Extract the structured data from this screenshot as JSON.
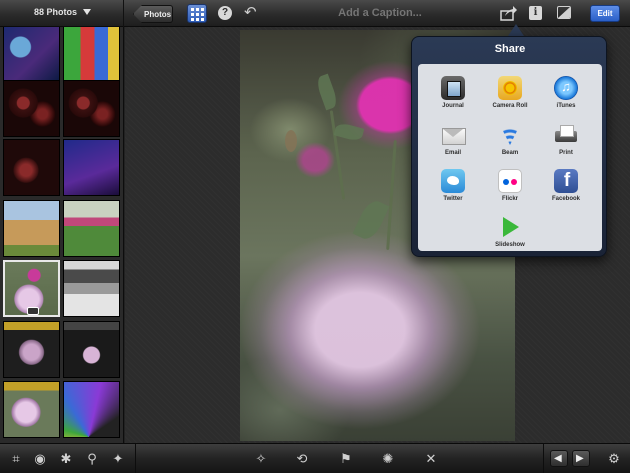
{
  "header": {
    "photo_count": "88 Photos",
    "back_label": "Photos",
    "help_glyph": "?",
    "caption_placeholder": "Add a Caption...",
    "info_glyph": "i",
    "edit_label": "Edit"
  },
  "share": {
    "title": "Share",
    "items": [
      {
        "label": "Journal",
        "icon": "journal-icon"
      },
      {
        "label": "Camera Roll",
        "icon": "camera-roll-icon"
      },
      {
        "label": "iTunes",
        "icon": "itunes-icon"
      },
      {
        "label": "Email",
        "icon": "email-icon"
      },
      {
        "label": "Beam",
        "icon": "beam-icon"
      },
      {
        "label": "Print",
        "icon": "print-icon"
      },
      {
        "label": "Twitter",
        "icon": "twitter-icon"
      },
      {
        "label": "Flickr",
        "icon": "flickr-icon"
      },
      {
        "label": "Facebook",
        "icon": "facebook-icon"
      },
      {
        "label": "Slideshow",
        "icon": "slideshow-icon"
      }
    ]
  },
  "colors": {
    "accent": "#2f5db8",
    "popover": "#2b3a55"
  }
}
